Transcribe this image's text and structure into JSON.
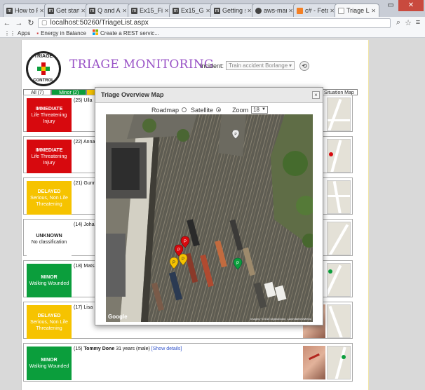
{
  "browser": {
    "tabs": [
      {
        "label": "How to P",
        "favicon": "m"
      },
      {
        "label": "Get starte",
        "favicon": "m"
      },
      {
        "label": "Q and A -",
        "favicon": "m"
      },
      {
        "label": "Ex15_Final",
        "favicon": "m"
      },
      {
        "label": "Ex15_GetM",
        "favicon": "m"
      },
      {
        "label": "Getting sp",
        "favicon": "m"
      },
      {
        "label": "aws-mana",
        "favicon": "github"
      },
      {
        "label": "c# - Fetch",
        "favicon": "so"
      },
      {
        "label": "Triage List",
        "favicon": "page"
      }
    ],
    "url": "localhost:50260/TriageList.aspx",
    "bookmarks": [
      {
        "label": "Apps",
        "icon": "apps-grid-icon"
      },
      {
        "label": "Energy in Balance",
        "icon": "bookmark-icon"
      },
      {
        "label": "Create a REST servic...",
        "icon": "windows-logo-icon"
      }
    ]
  },
  "page": {
    "logo": {
      "top": "TRIAGE",
      "bottom": "CONTROL"
    },
    "title": "TRIAGE MONITORING",
    "incident_label": "Incident:",
    "incident_value": "Train accident Borlange",
    "filters": {
      "all": "All (7)",
      "minor": "Minor (2)",
      "situation": "Situation Map"
    },
    "patients": [
      {
        "num": "(25)",
        "name": "Ulla",
        "status_title": "IMMEDIATE",
        "status_desc": "Life Threatening Injury",
        "status": "immediate"
      },
      {
        "num": "(22)",
        "name": "Anna",
        "status_title": "IMMEDIATE",
        "status_desc": "Life Threatening Injury",
        "status": "immediate"
      },
      {
        "num": "(21)",
        "name": "Gunn",
        "status_title": "DELAYED",
        "status_desc": "Serious, Non Life Threatening",
        "status": "delayed"
      },
      {
        "num": "(14)",
        "name": "Johan",
        "status_title": "UNKNOWN",
        "status_desc": "No classification",
        "status": "unknown"
      },
      {
        "num": "(18)",
        "name": "Mats",
        "status_title": "MINOR",
        "status_desc": "Walking Wounded",
        "status": "minor"
      },
      {
        "num": "(17)",
        "name": "Lisa",
        "status_title": "DELAYED",
        "status_desc": "Serious, Non Life Threatening",
        "status": "delayed"
      },
      {
        "num": "(15)",
        "name": "Tommy Done",
        "age": "31 years",
        "gender": "(male)",
        "link": "[Show details]",
        "status_title": "MINOR",
        "status_desc": "Walking Wounded",
        "status": "minor"
      }
    ]
  },
  "modal": {
    "title": "Triage Overview Map",
    "roadmap_label": "Roadmap",
    "satellite_label": "Satellite",
    "zoom_label": "Zoom",
    "zoom_value": "18",
    "google": "Google",
    "attribution": "Imagery ©2015 DigitalGlobe, Lantmäteriet/Metria"
  },
  "colors": {
    "immediate": "#d7090e",
    "delayed": "#f6c300",
    "minor": "#0b9e3c",
    "title": "#9a54c7"
  }
}
